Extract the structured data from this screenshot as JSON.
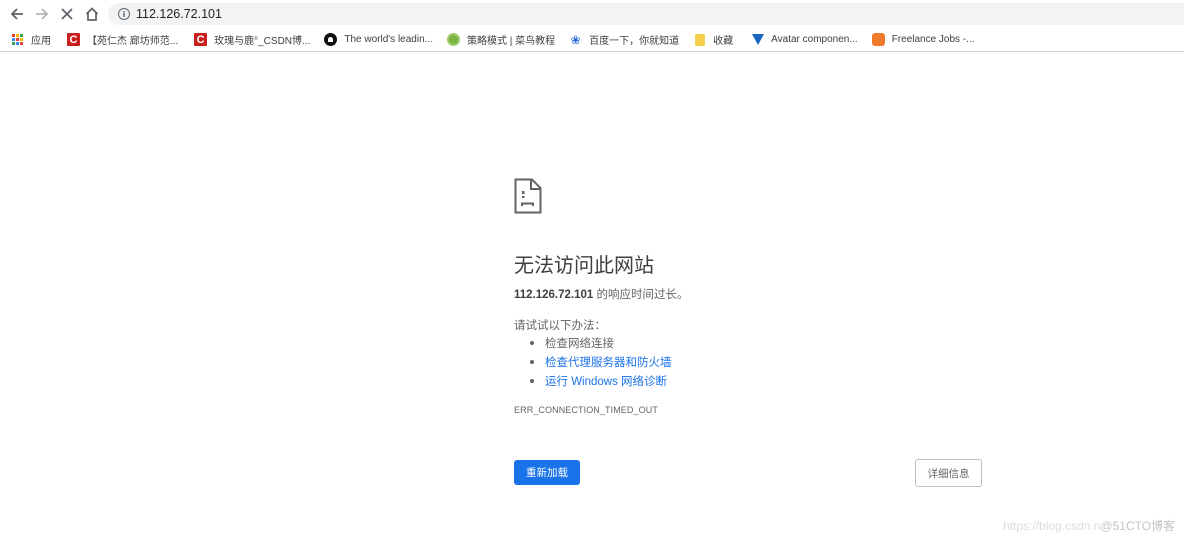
{
  "browser": {
    "url": "112.126.72.101",
    "nav": {
      "back_icon": "arrow-left-icon",
      "forward_icon": "arrow-right-icon",
      "stop_icon": "close-icon",
      "home_icon": "home-icon"
    }
  },
  "bookmarks": [
    {
      "label": "应用",
      "icon": "apps-grid-icon"
    },
    {
      "label": "【苑仁杰 廊坊师范...",
      "icon": "csdn-icon"
    },
    {
      "label": "玫瑰与鹿°_CSDN博...",
      "icon": "csdn-icon"
    },
    {
      "label": "The world's leadin...",
      "icon": "github-icon"
    },
    {
      "label": "策略模式 | 菜鸟教程",
      "icon": "runoob-icon"
    },
    {
      "label": "百度一下，你就知道",
      "icon": "baidu-icon"
    },
    {
      "label": "收藏",
      "icon": "folder-icon"
    },
    {
      "label": "Avatar componen...",
      "icon": "vuetify-icon"
    },
    {
      "label": "Freelance Jobs -...",
      "icon": "freelance-icon"
    }
  ],
  "error": {
    "icon": "sad-page-icon",
    "title": "无法访问此网站",
    "host": "112.126.72.101",
    "subtitle_suffix": " 的响应时间过长。",
    "try_label": "请试试以下办法：",
    "suggestions": [
      {
        "label": "检查网络连接",
        "link": false
      },
      {
        "label": "检查代理服务器和防火墙",
        "link": true
      },
      {
        "label": "运行 Windows 网络诊断",
        "link": true
      }
    ],
    "code": "ERR_CONNECTION_TIMED_OUT",
    "reload_label": "重新加载",
    "details_label": "详细信息"
  },
  "watermark": {
    "url_part": "https://blog.csdn.n",
    "brand_part": "@51CTO博客"
  },
  "colors": {
    "accent": "#1a73e8",
    "text": "#646464",
    "title": "#3c4043"
  }
}
